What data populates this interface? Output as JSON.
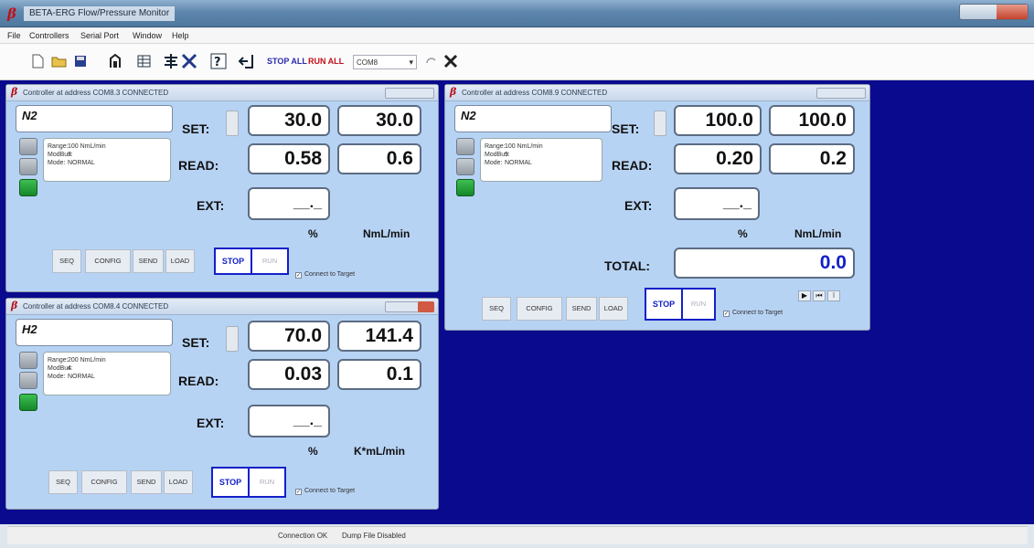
{
  "app": {
    "title": "BETA-ERG Flow/Pressure Monitor"
  },
  "menu": [
    "File",
    "Controllers",
    "Serial Port",
    "Window",
    "Help"
  ],
  "toolbar": {
    "stop_all": "STOP ALL",
    "run_all": "RUN ALL",
    "port": "COM8",
    "port_arrow": "▾"
  },
  "panels": [
    {
      "title": "Controller at address COM8.3 CONNECTED",
      "name": "N2",
      "info": {
        "range_label": "Range:",
        "range": "100 NmL/min",
        "modbus_label": "ModBus:",
        "modbus": "3",
        "mode_label": "Mode:",
        "mode": "NORMAL"
      },
      "set_label": "SET:",
      "set": "30.0",
      "set2": "30.0",
      "read_label": "READ:",
      "read": "0.58",
      "read2": "0.6",
      "ext_label": "EXT:",
      "ext": "__._",
      "pct": "%",
      "unit": "NmL/min",
      "buttons": {
        "seq": "SEQ",
        "config": "CONFIG",
        "send": "SEND",
        "load": "LOAD",
        "stop": "STOP",
        "run": "RUN"
      },
      "connect": "Connect to Target"
    },
    {
      "title": "Controller at address COM8.9 CONNECTED",
      "name": "N2",
      "info": {
        "range_label": "Range:",
        "range": "100 NmL/min",
        "modbus_label": "ModBus:",
        "modbus": "9",
        "mode_label": "Mode:",
        "mode": "NORMAL"
      },
      "set_label": "SET:",
      "set": "100.0",
      "set2": "100.0",
      "read_label": "READ:",
      "read": "0.20",
      "read2": "0.2",
      "ext_label": "EXT:",
      "ext": "__._",
      "pct": "%",
      "unit": "NmL/min",
      "total_label": "TOTAL:",
      "total": "0.0",
      "buttons": {
        "seq": "SEQ",
        "config": "CONFIG",
        "send": "SEND",
        "load": "LOAD",
        "stop": "STOP",
        "run": "RUN"
      },
      "connect": "Connect to Target"
    },
    {
      "title": "Controller at address COM8.4 CONNECTED",
      "name": "H2",
      "info": {
        "range_label": "Range:",
        "range": "200 NmL/min",
        "modbus_label": "ModBus:",
        "modbus": "4",
        "mode_label": "Mode:",
        "mode": "NORMAL"
      },
      "set_label": "SET:",
      "set": "70.0",
      "set2": "141.4",
      "read_label": "READ:",
      "read": "0.03",
      "read2": "0.1",
      "ext_label": "EXT:",
      "ext": "__._",
      "pct": "%",
      "unit": "K*mL/min",
      "buttons": {
        "seq": "SEQ",
        "config": "CONFIG",
        "send": "SEND",
        "load": "LOAD",
        "stop": "STOP",
        "run": "RUN"
      },
      "connect": "Connect to Target"
    }
  ],
  "status": {
    "connection": "Connection OK",
    "dump": "Dump File Disabled"
  },
  "colors": {
    "workspace": "#0a0a8e",
    "panel": "#b7d3f4",
    "stop": "#1320c8"
  }
}
